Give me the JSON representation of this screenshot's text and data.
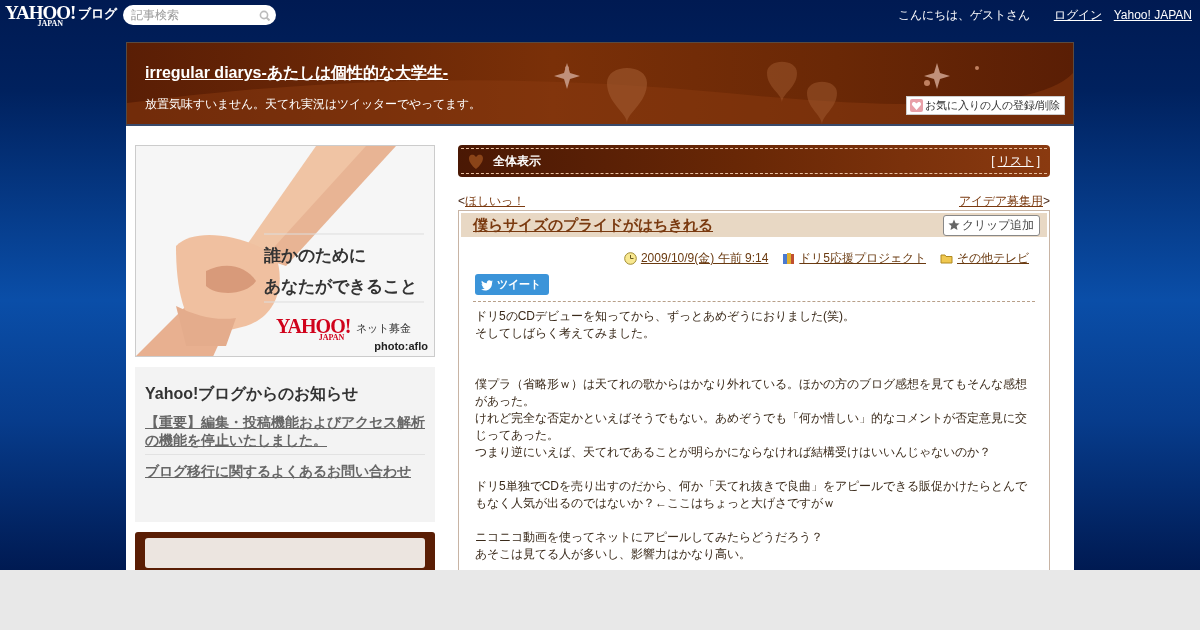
{
  "topbar": {
    "logo": "YAHOO!",
    "logo_sub": "JAPAN",
    "service": "ブログ",
    "search": {
      "placeholder": "記事検索"
    },
    "greeting": "こんにちは、ゲストさん",
    "links": [
      "ログイン",
      "Yahoo! JAPAN"
    ]
  },
  "blog_header": {
    "title": "irregular diarys-あたしは個性的な大学生-",
    "description": "放置気味すいません。天てれ実況はツイッターでやってます。",
    "favorite_button": "お気に入りの人の登録/削除"
  },
  "sidebar": {
    "ad": {
      "kind": "picture",
      "headline": [
        "誰かのために",
        "あなたができること"
      ],
      "logo": "YAHOO!",
      "logo_sub": "JAPAN",
      "service": "ネット募金",
      "credit": "photo:aflo"
    },
    "notices": {
      "title": "Yahoo!ブログからのお知らせ",
      "items": [
        "【重要】編集・投稿機能およびアクセス解析の機能を停止いたしました。",
        "ブログ移行に関するよくあるお問い合わせ"
      ]
    }
  },
  "main": {
    "section_title": "全体表示",
    "list_open": "[",
    "list_link": "リスト",
    "list_close": "]",
    "prev": {
      "mark": "<",
      "title": "ほしいっ！"
    },
    "next": {
      "title": "アイデア募集用",
      "mark": ">"
    },
    "article": {
      "title": "僕らサイズのプライドがはちきれる",
      "clip_button": "クリップ追加",
      "date": "2009/10/9(金) 午前 9:14",
      "category": "ドリ5応援プロジェクト",
      "folder": "その他テレビ",
      "tweet_button": "ツイート",
      "paragraphs": [
        {
          "lines": [
            "ドリ5のCDデビューを知ってから、ずっとあめぞうにおりました(笑)。",
            "そしてしばらく考えてみました。"
          ]
        },
        {
          "lines": [
            "僕プラ（省略形ｗ）は天てれの歌からはかなり外れている。ほかの方のブログ感想を見てもそんな感想があった。",
            "けれど完全な否定かといえばそうでもない。あめぞうでも「何か惜しい」的なコメントが否定意見に交じってあった。",
            "つまり逆にいえば、天てれであることが明らかにならなければ結構受けはいいんじゃないのか？"
          ]
        },
        {
          "lines": [
            "ドリ5単独でCDを売り出すのだから、何か「天てれ抜きで良曲」をアピールできる販促かけたらとんでもなく人気が出るのではないか？←ここはちょっと大げさですがｗ"
          ]
        },
        {
          "lines": [
            "ニコニコ動画を使ってネットにアピールしてみたらどうだろう？",
            "あそこは見てる人が多いし、影響力はかなり高い。"
          ]
        }
      ]
    }
  }
}
